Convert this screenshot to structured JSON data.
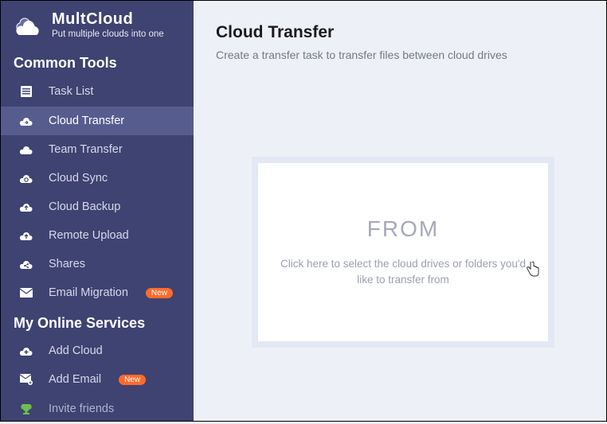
{
  "brand": {
    "name": "MultCloud",
    "tagline": "Put multiple clouds into one"
  },
  "sidebar": {
    "section1": "Common Tools",
    "items": [
      {
        "label": "Task List"
      },
      {
        "label": "Cloud Transfer"
      },
      {
        "label": "Team Transfer"
      },
      {
        "label": "Cloud Sync"
      },
      {
        "label": "Cloud Backup"
      },
      {
        "label": "Remote Upload"
      },
      {
        "label": "Shares"
      },
      {
        "label": "Email Migration",
        "badge": "New"
      }
    ],
    "section2": "My Online Services",
    "services": [
      {
        "label": "Add Cloud"
      },
      {
        "label": "Add Email",
        "badge": "New"
      }
    ],
    "invite": "Invite friends"
  },
  "main": {
    "title": "Cloud Transfer",
    "subtitle": "Create a transfer task to transfer files between cloud drives",
    "from": {
      "heading": "FROM",
      "desc": "Click here to select the cloud drives or folders you'd like to transfer from"
    }
  }
}
